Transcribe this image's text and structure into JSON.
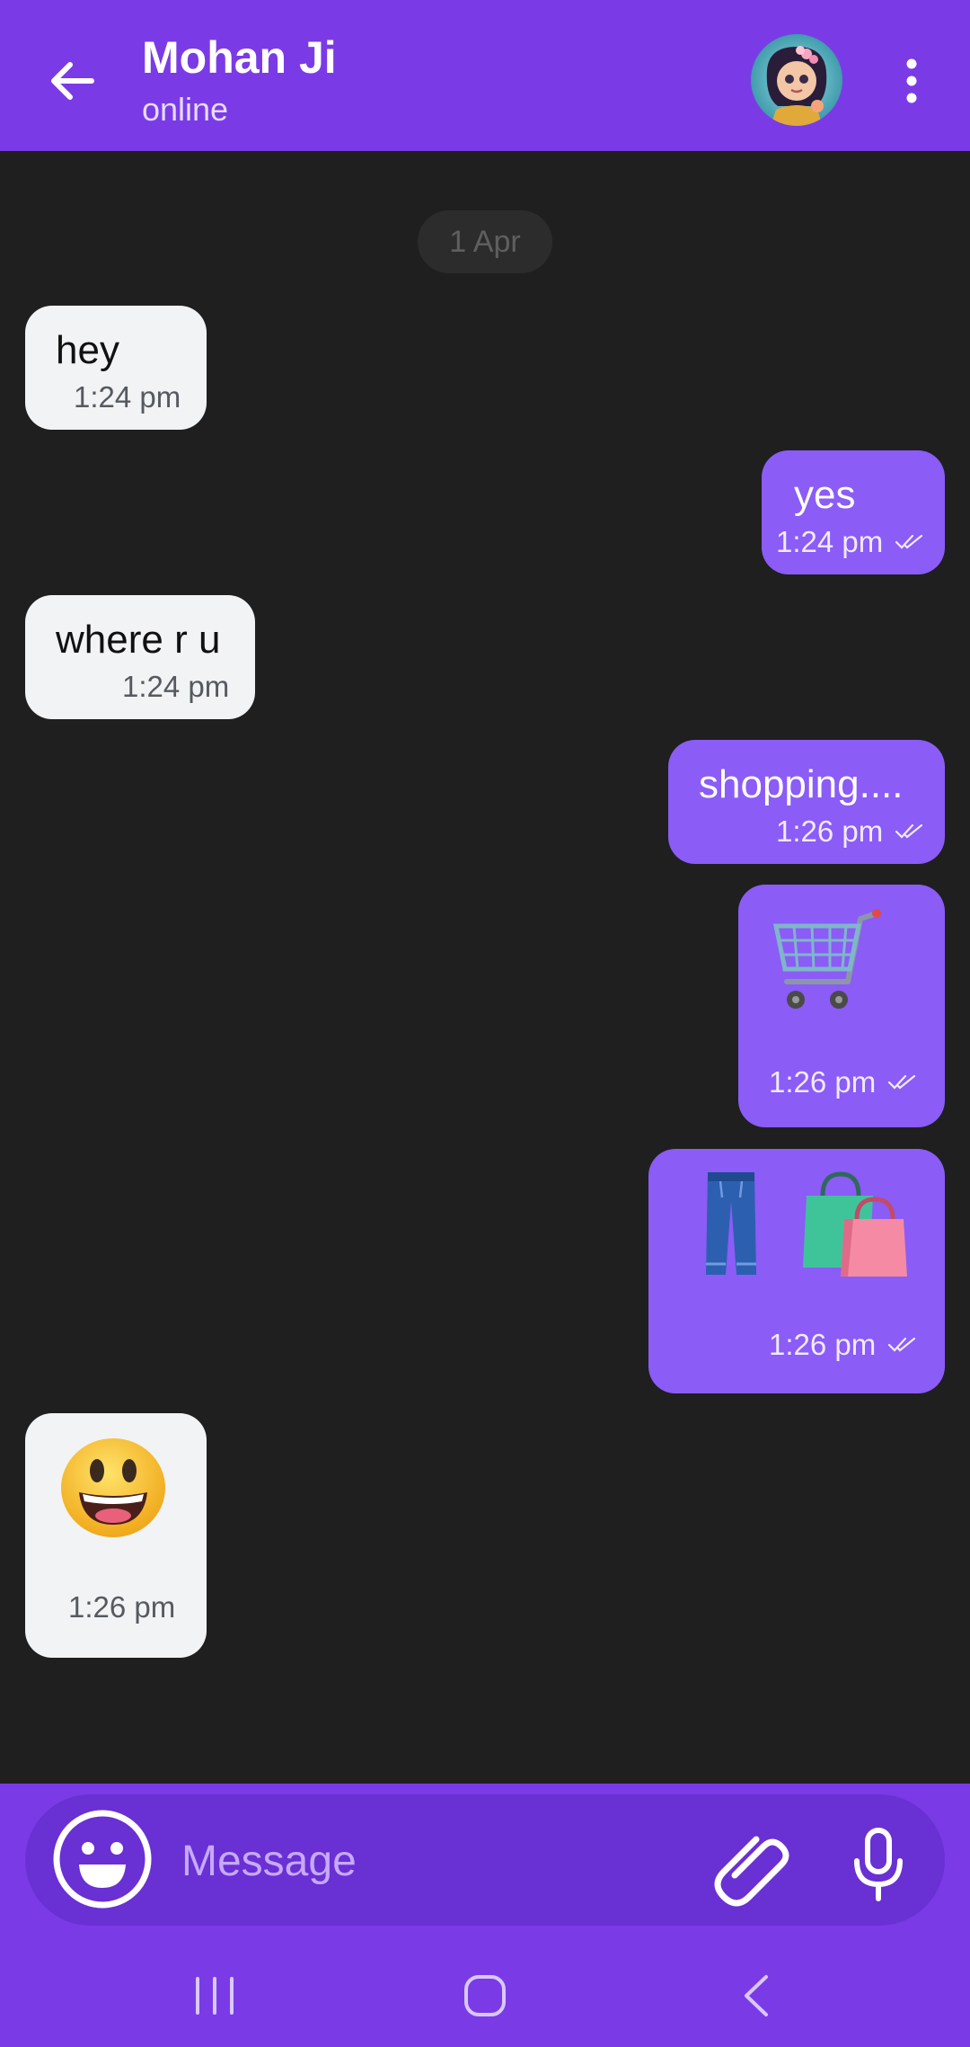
{
  "header": {
    "back_icon": "arrow-left-icon",
    "contact_name": "Mohan Ji",
    "status": "online",
    "avatar": "contact-avatar",
    "menu_icon": "more-vertical-icon",
    "color": "#7a3be6"
  },
  "chat": {
    "date_label": "1 Apr",
    "messages": [
      {
        "direction": "incoming",
        "text": "hey",
        "time": "1:24 pm"
      },
      {
        "direction": "outgoing",
        "text": "yes",
        "time": "1:24 pm",
        "status": "read"
      },
      {
        "direction": "incoming",
        "text": "where r u",
        "time": "1:24 pm"
      },
      {
        "direction": "outgoing",
        "text": "shopping....",
        "time": "1:26 pm",
        "status": "read"
      },
      {
        "direction": "outgoing",
        "sticker": "shopping-cart-emoji",
        "time": "1:26 pm",
        "status": "read"
      },
      {
        "direction": "outgoing",
        "sticker": "jeans-and-shopping-bags-emoji",
        "time": "1:26 pm",
        "status": "read"
      },
      {
        "direction": "incoming",
        "sticker": "grinning-face-emoji",
        "time": "1:26 pm"
      }
    ],
    "incoming_color": "#f2f3f5",
    "outgoing_color": "#8b5cf6"
  },
  "composer": {
    "emoji_icon": "smiley-icon",
    "placeholder": "Message",
    "attach_icon": "paperclip-icon",
    "mic_icon": "microphone-icon"
  },
  "navbar": {
    "recent_icon": "recent-apps-icon",
    "home_icon": "home-icon",
    "back_icon": "back-icon"
  }
}
